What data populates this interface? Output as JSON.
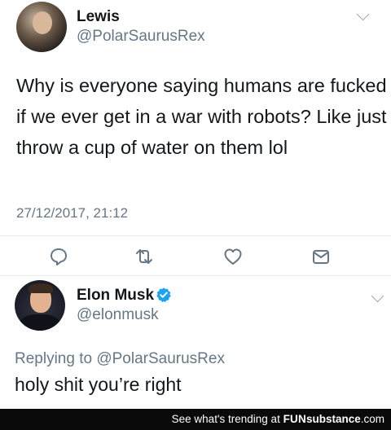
{
  "tweet": {
    "author_name": "Lewis",
    "author_handle": "@PolarSaurusRex",
    "text": "Why is everyone saying humans are fucked if we ever get in a war with robots? Like just throw a cup of water on them lol",
    "timestamp": "27/12/2017, 21:12",
    "actions": [
      {
        "icon": "reply-icon"
      },
      {
        "icon": "retweet-icon"
      },
      {
        "icon": "like-icon"
      },
      {
        "icon": "direct-message-icon"
      }
    ]
  },
  "reply": {
    "author_name": "Elon Musk",
    "author_handle": "@elonmusk",
    "verified": true,
    "replying_prefix": "Replying to",
    "replying_to": "@PolarSaurusRex",
    "text": "holy shit you’re right"
  },
  "footer": {
    "prefix": "See what's trending at",
    "brand_part1": "FUN",
    "brand_part2": "substance",
    "brand_suffix": ".com"
  },
  "colors": {
    "text_primary": "#14171a",
    "text_secondary": "#657786",
    "verified_blue": "#1da1f2",
    "footer_bg": "#0a0a0a"
  }
}
